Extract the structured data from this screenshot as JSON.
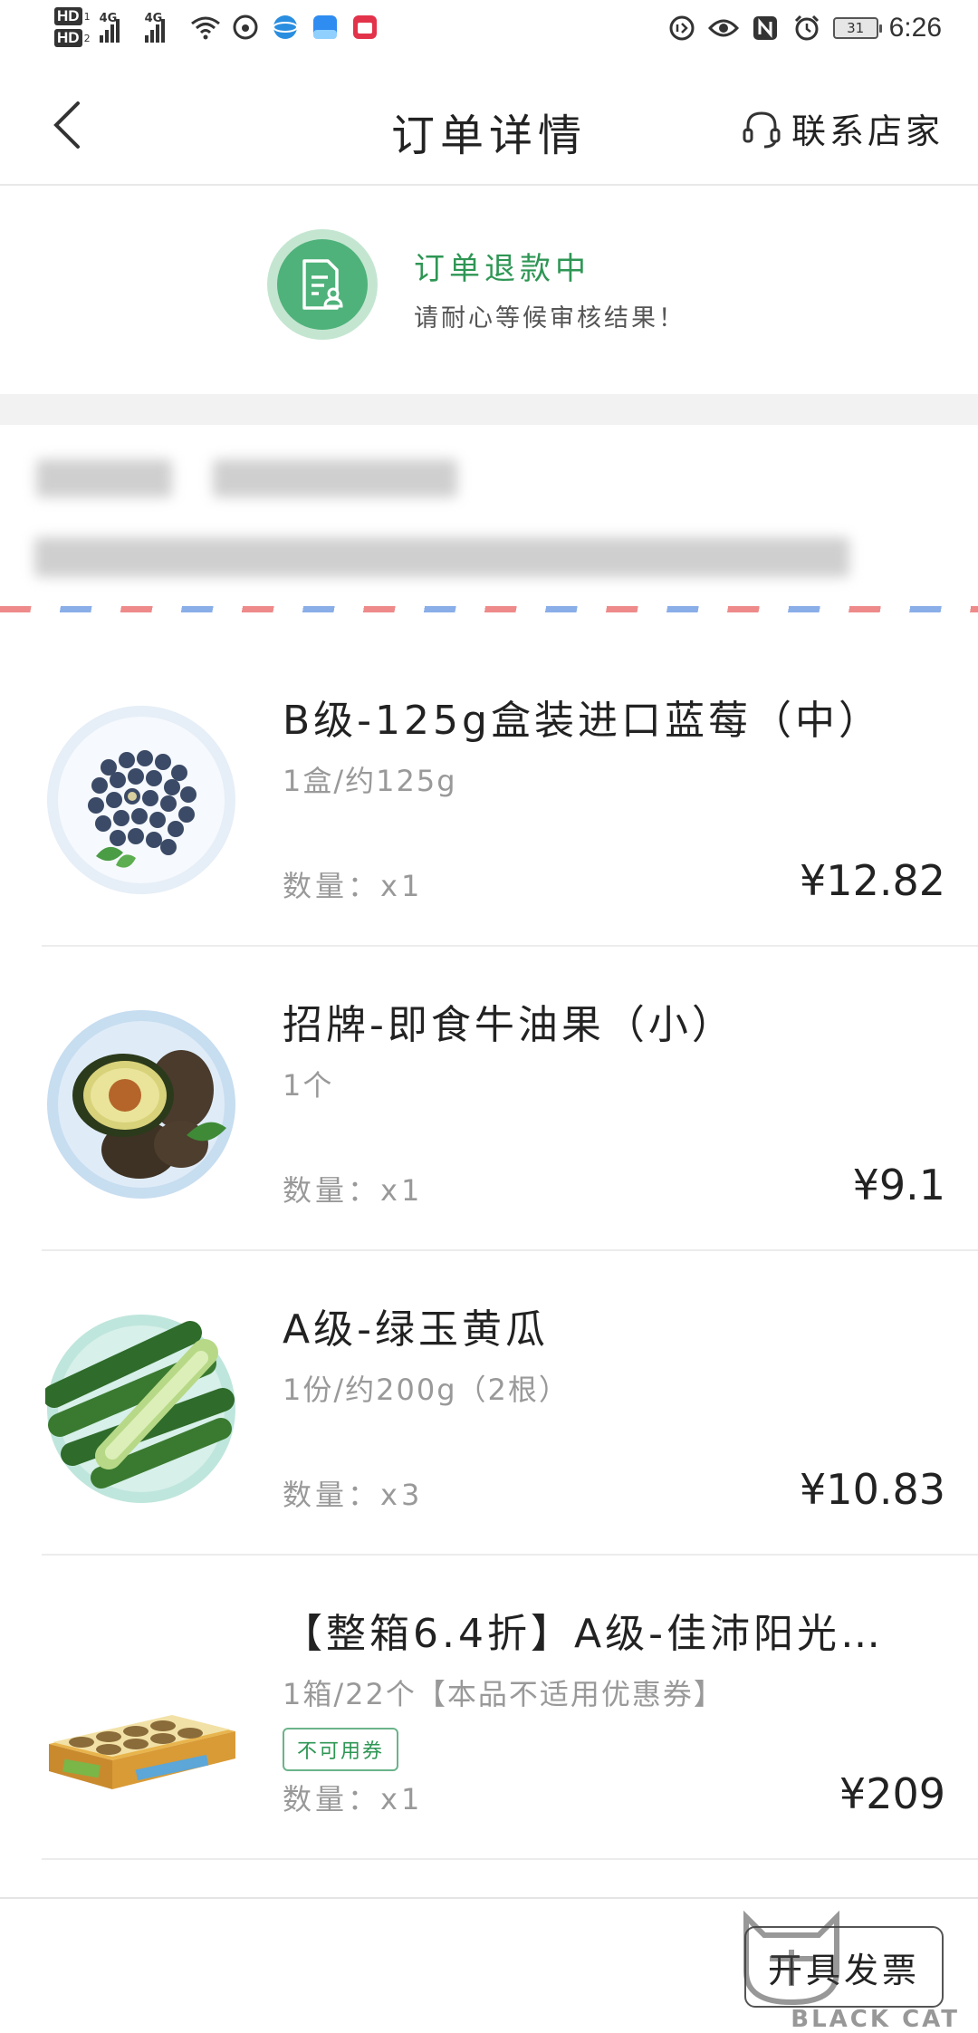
{
  "status_bar": {
    "hd1": "HD",
    "hd1_sub": "1",
    "hd2": "HD",
    "hd2_sub": "2",
    "net1": "4G",
    "net2": "4G",
    "battery": "31",
    "time": "6:26"
  },
  "header": {
    "title": "订单详情",
    "contact_label": "联系店家"
  },
  "order_status": {
    "title": "订单退款中",
    "subtitle": "请耐心等候审核结果！",
    "icon": "document-person-icon",
    "accent_color": "#2e9654"
  },
  "items": [
    {
      "name": "B级-125g盒装进口蓝莓（中）",
      "spec": "1盒/约125g",
      "qty": "数量：x1",
      "price_symbol": "¥",
      "price": "12.82",
      "image": "blueberry-plate"
    },
    {
      "name": "招牌-即食牛油果（小）",
      "spec": "1个",
      "qty": "数量：x1",
      "price_symbol": "¥",
      "price": "9.1",
      "image": "avocado-plate"
    },
    {
      "name": "A级-绿玉黄瓜",
      "spec": "1份/约200g（2根）",
      "qty": "数量：x3",
      "price_symbol": "¥",
      "price": "10.83",
      "image": "cucumber-plate"
    },
    {
      "name": "【整箱6.4折】A级-佳沛阳光…",
      "spec": "1箱/22个【本品不适用优惠券】",
      "tag": "不可用券",
      "qty": "数量：x1",
      "price_symbol": "¥",
      "price": "209",
      "image": "kiwi-box"
    }
  ],
  "bottom": {
    "invoice_label": "开具发票",
    "watermark_text": "BLACK CAT"
  }
}
